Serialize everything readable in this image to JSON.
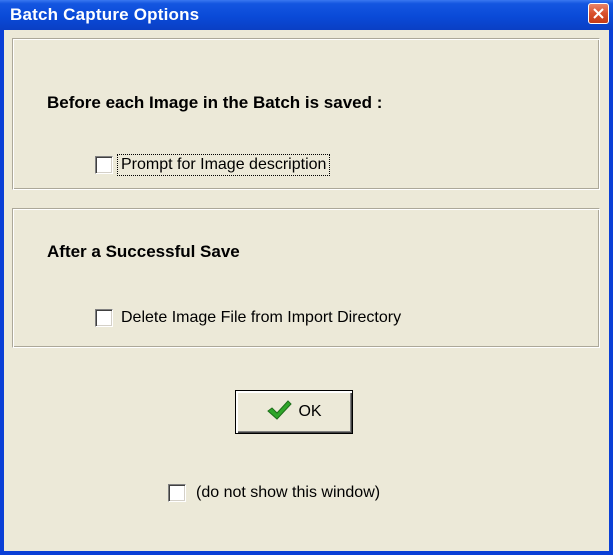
{
  "window": {
    "title": "Batch Capture Options",
    "close_icon": "close-icon"
  },
  "before_save": {
    "heading": "Before each Image in the Batch is saved :",
    "prompt_description": {
      "label": "Prompt for Image description",
      "checked": false
    }
  },
  "after_save": {
    "heading": "After a Successful Save",
    "delete_file": {
      "label": "Delete Image File from Import Directory",
      "checked": false
    }
  },
  "ok_button": {
    "label": "OK",
    "icon": "checkmark-icon"
  },
  "do_not_show": {
    "label": "(do not show this window)",
    "checked": false
  },
  "colors": {
    "titlebar": "#0a4ad8",
    "dialog_background": "#ece9d8",
    "checkmark": "#2fa62a",
    "close_button": "#d9502c"
  }
}
